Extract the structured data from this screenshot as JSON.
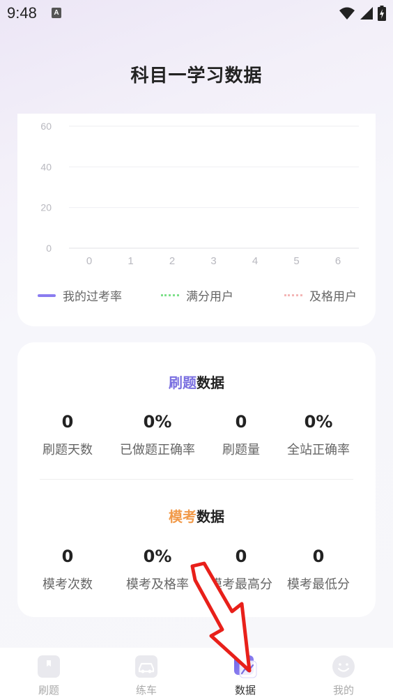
{
  "status_bar": {
    "time": "9:48",
    "indicator": "A",
    "icons": [
      "wifi-icon",
      "signal-icon",
      "battery-charging-icon"
    ]
  },
  "page": {
    "title": "科目一学习数据"
  },
  "chart_data": {
    "type": "line",
    "x": [
      0,
      1,
      2,
      3,
      4,
      5,
      6
    ],
    "xticks": [
      "0",
      "1",
      "2",
      "3",
      "4",
      "5",
      "6"
    ],
    "yticks": [
      "0",
      "20",
      "40",
      "60"
    ],
    "ylim": [
      0,
      60
    ],
    "grid": true,
    "legend_position": "bottom",
    "series": [
      {
        "name": "我的过考率",
        "values": [],
        "color": "#8a7cf0",
        "style": "solid"
      },
      {
        "name": "满分用户",
        "values": [],
        "color": "#7ee08a",
        "style": "dotted"
      },
      {
        "name": "及格用户",
        "values": [],
        "color": "#f4b6b6",
        "style": "dotted"
      }
    ]
  },
  "practice": {
    "title_highlight": "刷题",
    "title_rest": "数据",
    "highlight_color": "#7a6fe0",
    "stats": [
      {
        "value": "0",
        "label": "刷题天数"
      },
      {
        "value": "0%",
        "label": "已做题正确率"
      },
      {
        "value": "0",
        "label": "刷题量"
      },
      {
        "value": "0%",
        "label": "全站正确率"
      }
    ]
  },
  "mock_exam": {
    "title_highlight": "模考",
    "title_rest": "数据",
    "highlight_color": "#f19a4a",
    "stats": [
      {
        "value": "0",
        "label": "模考次数"
      },
      {
        "value": "0%",
        "label": "模考及格率"
      },
      {
        "value": "0",
        "label": "模考最高分"
      },
      {
        "value": "0",
        "label": "模考最低分"
      }
    ]
  },
  "bottom_nav": {
    "items": [
      {
        "label": "刷题",
        "icon": "book-icon",
        "active": false
      },
      {
        "label": "练车",
        "icon": "car-icon",
        "active": false
      },
      {
        "label": "数据",
        "icon": "chart-icon",
        "active": true
      },
      {
        "label": "我的",
        "icon": "smiley-icon",
        "active": false
      }
    ]
  }
}
